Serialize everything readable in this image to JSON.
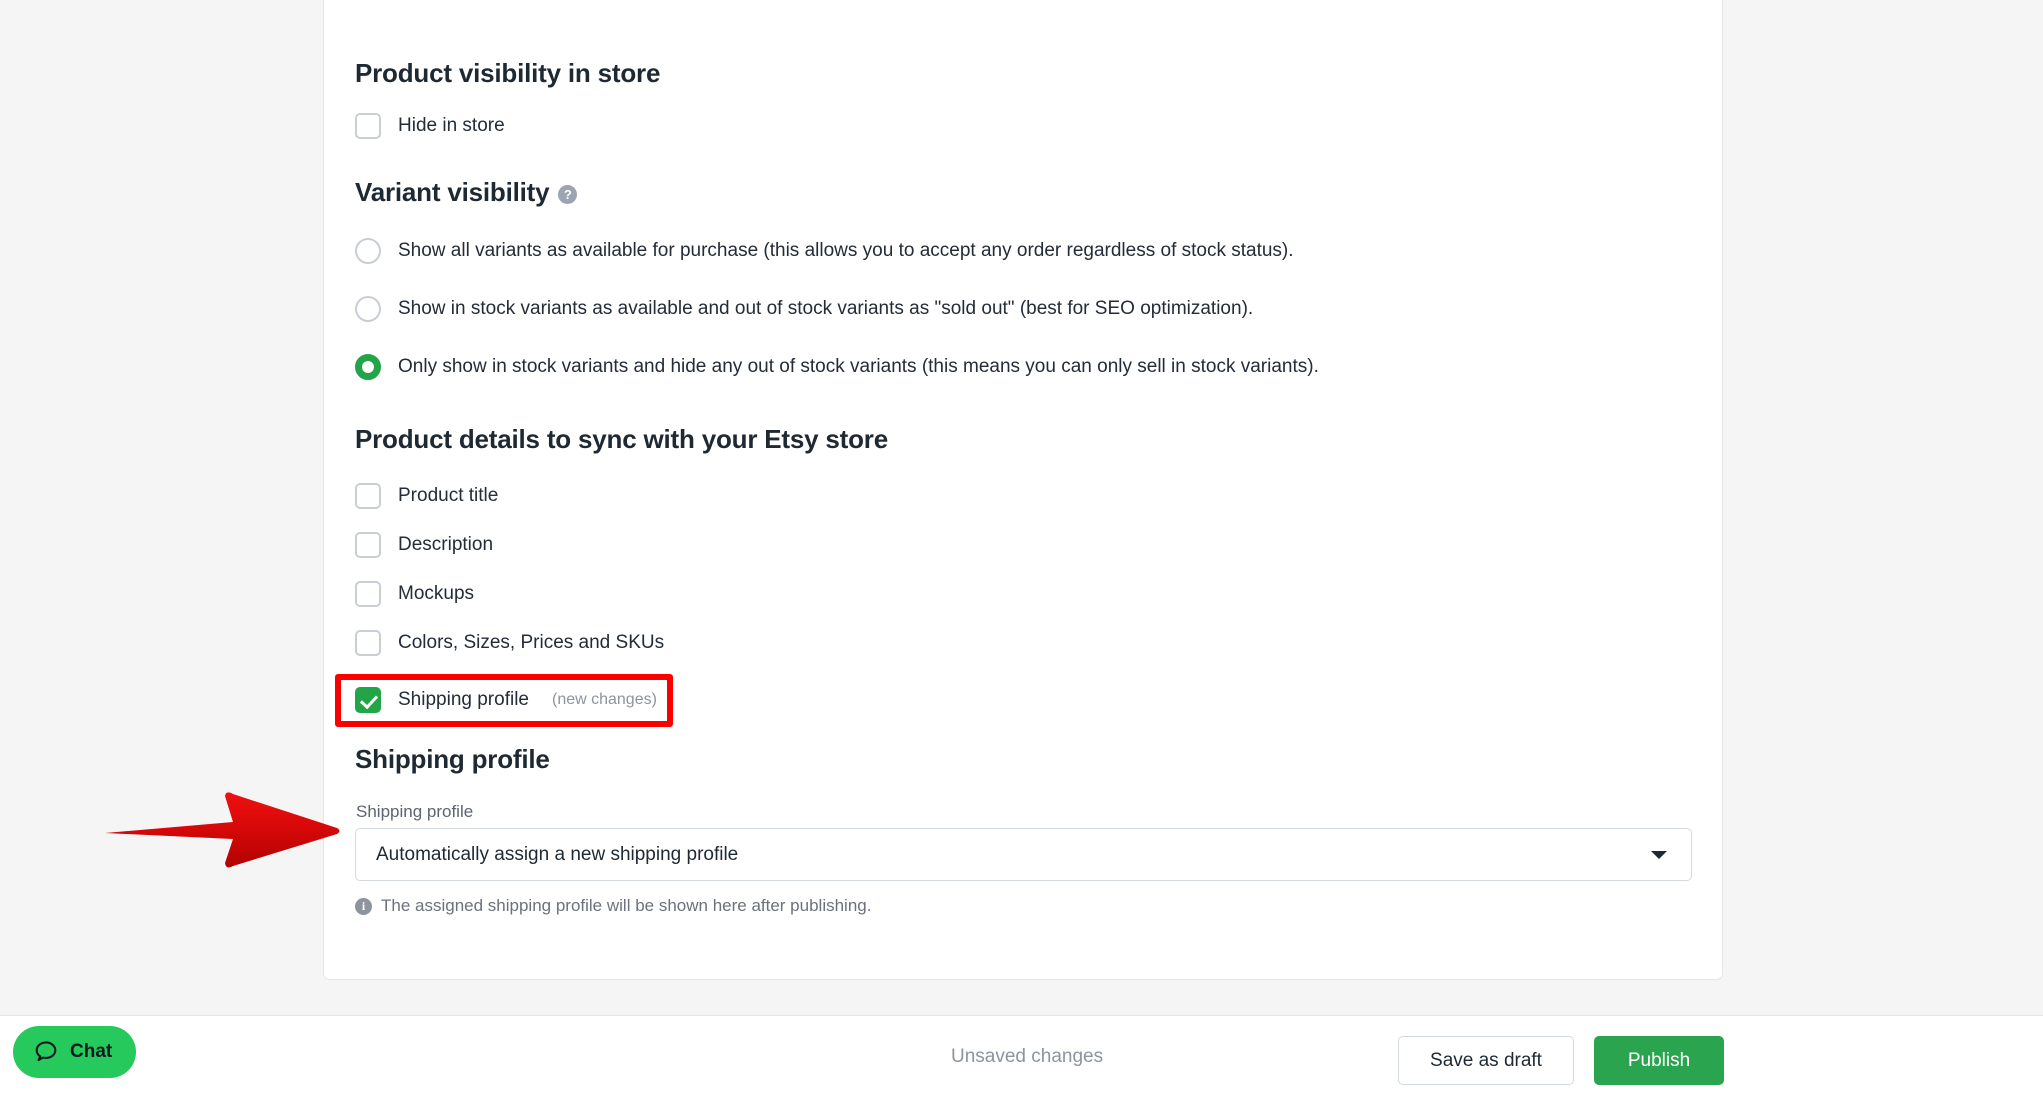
{
  "sections": {
    "product_visibility": {
      "title": "Product visibility in store",
      "options": [
        {
          "label": "Hide in store",
          "checked": false
        }
      ]
    },
    "variant_visibility": {
      "title": "Variant visibility",
      "help_icon": "?",
      "options": [
        {
          "label": "Show all variants as available for purchase (this allows you to accept any order regardless of stock status).",
          "selected": false
        },
        {
          "label": "Show in stock variants as available and out of stock variants as \"sold out\" (best for SEO optimization).",
          "selected": false
        },
        {
          "label": "Only show in stock variants and hide any out of stock variants (this means you can only sell in stock variants).",
          "selected": true
        }
      ]
    },
    "sync_details": {
      "title": "Product details to sync with your Etsy store",
      "options": [
        {
          "label": "Product title",
          "note": "",
          "checked": false
        },
        {
          "label": "Description",
          "note": "",
          "checked": false
        },
        {
          "label": "Mockups",
          "note": "",
          "checked": false
        },
        {
          "label": "Colors, Sizes, Prices and SKUs",
          "note": "",
          "checked": false
        },
        {
          "label": "Shipping profile",
          "note": "(new changes)",
          "checked": true
        }
      ]
    },
    "shipping_profile": {
      "title": "Shipping profile",
      "field_label": "Shipping profile",
      "selected_value": "Automatically assign a new shipping profile",
      "helper_text": "The assigned shipping profile will be shown here after publishing.",
      "info_icon": "i"
    }
  },
  "footer": {
    "status_text": "Unsaved changes",
    "save_draft_label": "Save as draft",
    "publish_label": "Publish"
  },
  "chat": {
    "label": "Chat"
  },
  "colors": {
    "accent_green": "#21a547",
    "publish_green": "#2aa44f",
    "chat_green": "#25c95c",
    "annotation_red": "#fb0000",
    "text_dark": "#242c38",
    "text_muted": "#8d949e"
  }
}
